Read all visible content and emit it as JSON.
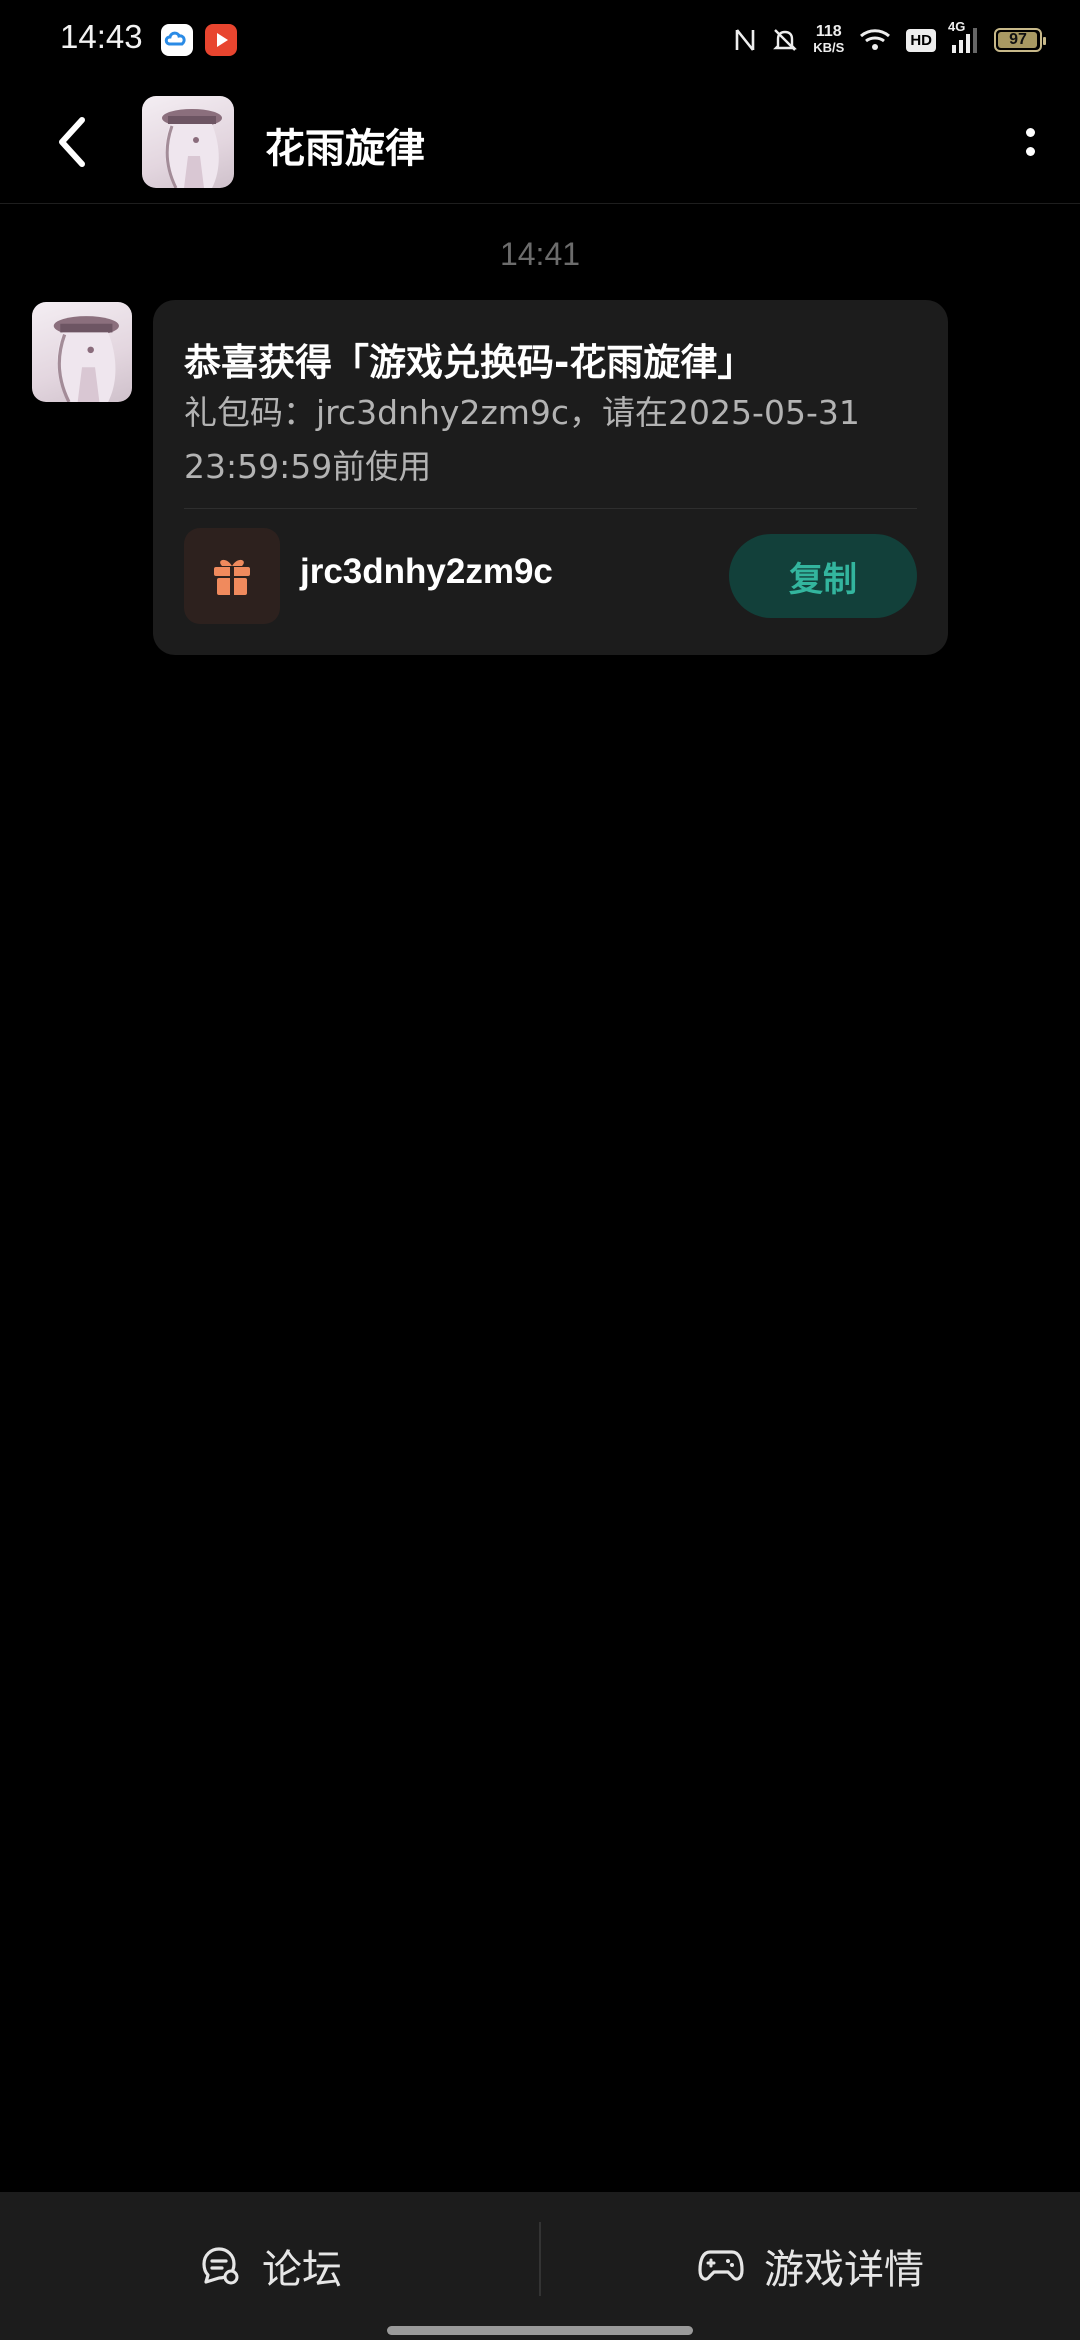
{
  "status_bar": {
    "time": "14:43",
    "speed_value": "118",
    "speed_unit": "KB/S",
    "hd_label": "HD",
    "network_label": "4G",
    "battery_percent": "97",
    "battery_level": 0.97
  },
  "header": {
    "title": "花雨旋律"
  },
  "chat": {
    "timestamp": "14:41",
    "message": {
      "title": "恭喜获得「游戏兑换码-花雨旋律」",
      "description": "礼包码：jrc3dnhy2zm9c，请在2025-05-31 23:59:59前使用",
      "code": "jrc3dnhy2zm9c",
      "copy_label": "复制"
    }
  },
  "bottom_bar": {
    "forum_label": "论坛",
    "details_label": "游戏详情"
  },
  "colors": {
    "accent": "#33b59e",
    "gift_icon": "#f08a5d",
    "card_bg": "#1c1c1c"
  }
}
